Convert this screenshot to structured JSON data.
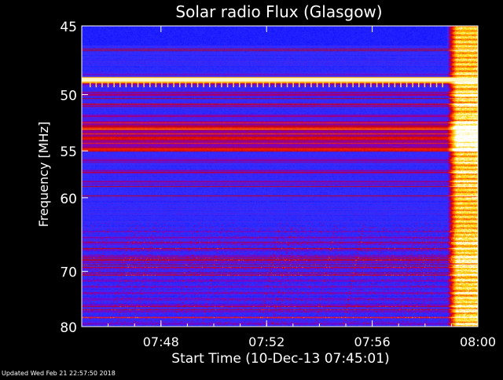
{
  "chart_data": {
    "type": "heatmap",
    "title": "Solar radio Flux (Glasgow)",
    "xlabel": "Start Time (10-Dec-13 07:45:01)",
    "ylabel": "Frequency [MHz]",
    "x_ticks": [
      "07:48",
      "07:52",
      "07:56",
      "08:00"
    ],
    "x_tick_values_min": [
      3,
      7,
      11,
      15
    ],
    "xlim_min": [
      0,
      15
    ],
    "y_ticks": [
      45,
      50,
      55,
      60,
      70,
      80
    ],
    "ylim": [
      45,
      80
    ],
    "y_scale": "reciprocal",
    "colormap": [
      "#000060",
      "#0000ff",
      "#3030ff",
      "#8000c0",
      "#cc0000",
      "#ff3000",
      "#ff9000",
      "#ffe000",
      "#ffffff"
    ],
    "background_level": "low (blue)",
    "features": [
      {
        "name": "constant bright band",
        "freq_mhz": 48.8,
        "level": "max"
      },
      {
        "name": "burst onset",
        "time": "07:58:50",
        "freq_range_mhz": [
          45,
          80
        ],
        "level": "high"
      }
    ]
  },
  "footer": {
    "updated": "Updated Wed Feb 21 22:57:50 2018"
  }
}
